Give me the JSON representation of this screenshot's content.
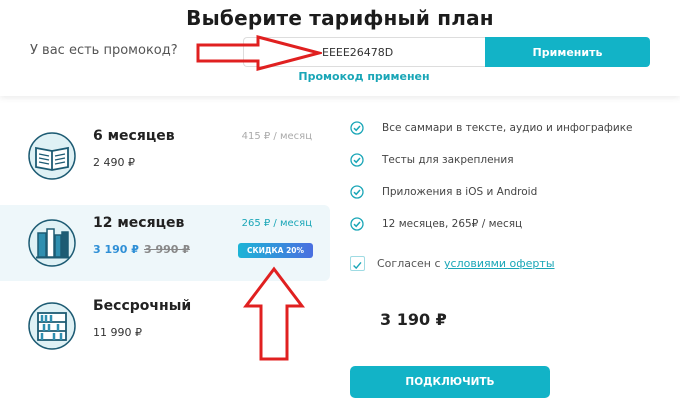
{
  "header": {
    "title": "Выберите тарифный план"
  },
  "promo": {
    "question": "У вас есть промокод?",
    "code_value": "EEEE26478D",
    "apply_label": "Применить",
    "status": "Промокод применен"
  },
  "plans": [
    {
      "name": "6 месяцев",
      "price": "2 490 ₽",
      "per_month": "415 ₽ / месяц"
    },
    {
      "name": "12 месяцев",
      "price_new": "3 190 ₽",
      "price_old": "3 990 ₽",
      "per_month": "265 ₽ / месяц",
      "badge": "СКИДКА 20%"
    },
    {
      "name": "Бессрочный",
      "price": "11 990 ₽"
    }
  ],
  "features": [
    "Все саммари в тексте, аудио и инфографике",
    "Тесты для закрепления",
    "Приложения в iOS и Android",
    "12 месяцев, 265₽ / месяц"
  ],
  "agreement": {
    "prefix": "Согласен с",
    "link": "условиями оферты"
  },
  "total": "3 190 ₽",
  "connect_label": "ПОДКЛЮЧИТЬ",
  "colors": {
    "accent": "#12b3c7",
    "selected_bg": "#eef7fa",
    "annotation_arrow": "#e02020"
  }
}
